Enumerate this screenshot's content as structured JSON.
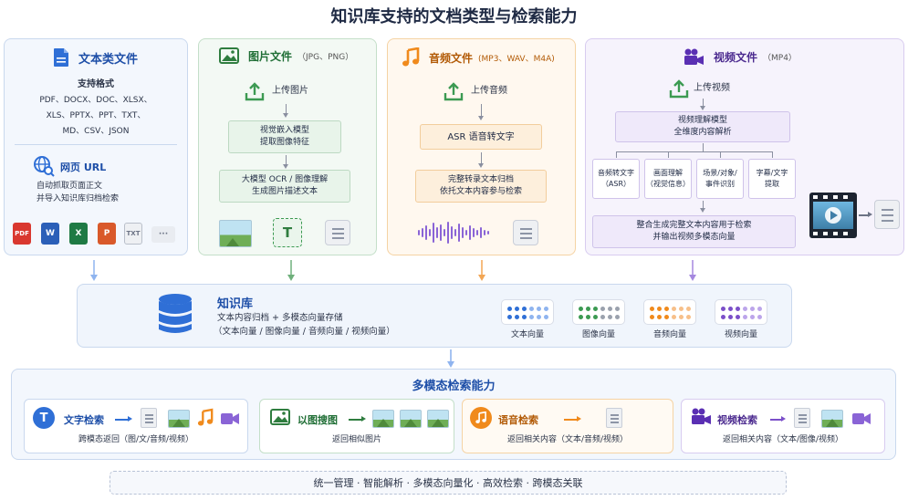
{
  "title": "知识库支持的文档类型与检索能力",
  "text_panel": {
    "title": "文本类文件",
    "formats_title": "支持格式",
    "formats_lines": [
      "PDF、DOCX、DOC、XLSX、",
      "XLS、PPTX、PPT、TXT、",
      "MD、CSV、JSON"
    ],
    "web_title": "网页 URL",
    "web_desc": [
      "自动抓取页面正文",
      "并导入知识库归档检索"
    ],
    "format_icons": [
      "PDF",
      "W",
      "X",
      "P",
      "TXT",
      "···"
    ]
  },
  "image_panel": {
    "title": "图片文件",
    "subtitle": "（JPG、PNG）",
    "upload": "上传图片",
    "step1": [
      "视觉嵌入模型",
      "提取图像特征"
    ],
    "step2": [
      "大模型 OCR / 图像理解",
      "生成图片描述文本"
    ],
    "icon_t": "T"
  },
  "audio_panel": {
    "title": "音频文件",
    "subtitle": "(MP3、WAV、M4A)",
    "upload": "上传音频",
    "step1": "ASR 语音转文字",
    "step2": [
      "完整转录文本归档",
      "依托文本内容参与检索"
    ]
  },
  "video_panel": {
    "title": "视频文件",
    "subtitle": "（MP4）",
    "upload": "上传视频",
    "model": [
      "视频理解模型",
      "全维度内容解析"
    ],
    "branches": [
      [
        "音频转文字",
        "（ASR）"
      ],
      [
        "画面理解",
        "（视觉信息）"
      ],
      [
        "场景/对象/",
        "事件识别"
      ],
      [
        "字幕/文字",
        "提取"
      ]
    ],
    "merge": [
      "整合生成完整文本内容用于检索",
      "并输出视频多模态向量"
    ]
  },
  "knowledge_base": {
    "title": "知识库",
    "desc1": "文本内容归档 + 多模态向量存储",
    "desc2": "（文本向量 / 图像向量 / 音频向量 / 视频向量）",
    "vectors": [
      "文本向量",
      "图像向量",
      "音频向量",
      "视频向量"
    ]
  },
  "search": {
    "title": "多模态检索能力",
    "cards": [
      {
        "label": "文字检索",
        "desc": "跨模态返回（图/文/音频/视频）",
        "icon_text": "T"
      },
      {
        "label": "以图搜图",
        "desc": "返回相似图片"
      },
      {
        "label": "语音检索",
        "desc": "返回相关内容（文本/音频/视频）"
      },
      {
        "label": "视频检索",
        "desc": "返回相关内容（文本/图像/视频）"
      }
    ]
  },
  "footer": "统一管理 · 智能解析 · 多模态向量化 · 高效检索 · 跨模态关联",
  "colors": {
    "blue": "#2f6fd6",
    "green": "#3c9a52",
    "orange": "#f08a1c",
    "purple": "#7b4fc9"
  }
}
